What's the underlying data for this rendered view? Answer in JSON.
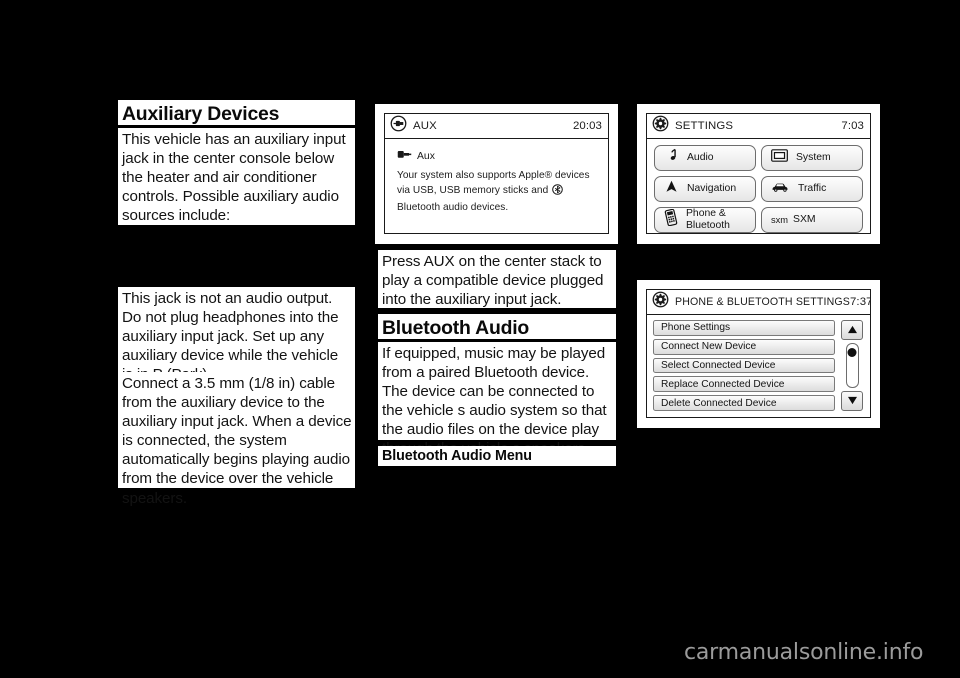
{
  "background_color": "#000000",
  "column1": {
    "heading": "Auxiliary Devices",
    "paragraph1": "This vehicle has an auxiliary input jack in the center console below the heater and air conditioner controls. Possible auxiliary audio sources include:",
    "paragraph2": "This jack is not an audio output. Do not plug headphones into the auxiliary input jack. Set up any auxiliary device while the vehicle is in P (Park).",
    "paragraph3": "Connect a 3.5 mm (1/8 in) cable from the auxiliary device to the auxiliary input jack. When a device is connected, the system automatically begins playing audio from the device over the vehicle speakers."
  },
  "column2": {
    "aux_screen": {
      "icon": "aux-plug-icon",
      "title": "AUX",
      "clock": "20:03",
      "source_icon": "aux-plug-small-icon",
      "source_label": "Aux",
      "body_part1": "Your system also supports Apple",
      "body_registered": "®",
      "body_part2": " devices via USB, USB memory sticks and ",
      "bluetooth_icon": "bluetooth-icon",
      "body_part3": " Bluetooth audio devices."
    },
    "paragraph1": "Press AUX on the center stack to play a compatible device plugged into the auxiliary input jack.",
    "heading": "Bluetooth Audio",
    "paragraph2": "If equipped, music may be played from a paired Bluetooth device. The device can be connected to the vehicle s audio system so that the audio files on the device play through the vehicle s speakers.",
    "subheading": "Bluetooth Audio Menu"
  },
  "column3": {
    "settings_screen": {
      "icon": "gear-icon",
      "title": "SETTINGS",
      "clock": "7:03",
      "tiles": [
        {
          "icon": "music-note-icon",
          "label": "Audio"
        },
        {
          "icon": "display-icon",
          "label": "System"
        },
        {
          "icon": "navigation-arrow-icon",
          "label": "Navigation"
        },
        {
          "icon": "traffic-car-icon",
          "label": "Traffic"
        },
        {
          "icon": "phone-icon",
          "label_line1": "Phone &",
          "label_line2": "Bluetooth"
        },
        {
          "icon": "sxm-text-icon",
          "label": "SXM",
          "prefix": "sxm"
        }
      ]
    },
    "phone_bluetooth_screen": {
      "icon": "gear-icon",
      "title": "PHONE & BLUETOOTH SETTINGS",
      "clock": "7:37",
      "items": [
        "Phone Settings",
        "Connect New Device",
        "Select Connected Device",
        "Replace Connected Device",
        "Delete Connected Device"
      ],
      "scroll_up_icon": "triangle-up-icon",
      "scroll_down_icon": "triangle-down-icon",
      "scroll_thumb": "scrollbar-thumb"
    }
  },
  "footer": {
    "watermark": "carmanualsonline.info"
  }
}
